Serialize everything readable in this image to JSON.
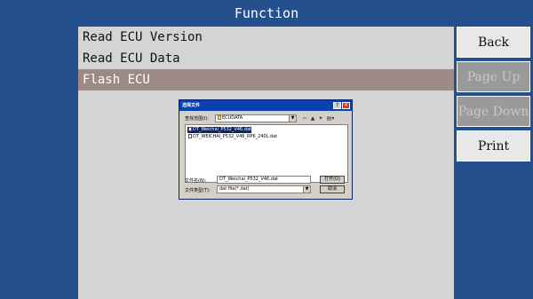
{
  "header": {
    "title": "Function"
  },
  "menu": {
    "items": [
      {
        "label": "Read ECU Version"
      },
      {
        "label": "Read ECU Data"
      },
      {
        "label": "Flash ECU"
      }
    ]
  },
  "side_buttons": {
    "back": "Back",
    "page_up": "Page Up",
    "page_down": "Page Down",
    "print": "Print"
  },
  "dialog": {
    "title": "选择文件",
    "look_in_label": "查找范围(I):",
    "look_in_value": "ECUDATA",
    "files": [
      {
        "name": "DT_Weichai_P532_V46.dat",
        "selected": true
      },
      {
        "name": "DT_WEICHAI_P532_V46_RP6_240L.dat",
        "selected": false
      }
    ],
    "filename_label": "文件名(N):",
    "filename_value": "DT_Weichai_P532_V46.dat",
    "filetype_label": "文件类型(T):",
    "filetype_value": "dat file(*.dat)",
    "open_button": "打开(O)",
    "cancel_button": "取消",
    "help_glyph": "?",
    "close_glyph": "×"
  },
  "colors": {
    "background": "#24508e",
    "panel": "#d4d4d4",
    "selected_row": "#9e8a84",
    "dialog_title": "#0a42b0"
  }
}
